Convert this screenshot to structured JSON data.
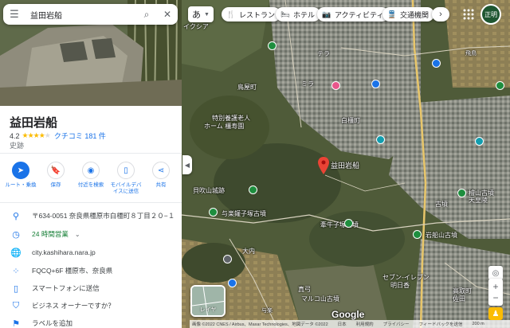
{
  "search": {
    "query": "益田岩船"
  },
  "place": {
    "name": "益田岩船",
    "rating": "4.2",
    "review_label": "クチコミ 181 件",
    "category": "史跡"
  },
  "actions": [
    {
      "label": "ルート・乗換",
      "icon": "directions-icon"
    },
    {
      "label": "保存",
      "icon": "bookmark-icon"
    },
    {
      "label": "付近を検索",
      "icon": "nearby-icon"
    },
    {
      "label": "モバイルデバイスに送信",
      "icon": "send-to-phone-icon"
    },
    {
      "label": "共有",
      "icon": "share-icon"
    }
  ],
  "info": {
    "address": "〒634-0051 奈良県橿原市白橿町８丁目２０−１",
    "hours": "24 時間営業",
    "website": "city.kashihara.nara.jp",
    "plus_code": "FQCQ+6F 橿原市、奈良県",
    "send_to_phone": "スマートフォンに送信",
    "owner": "ビジネス オーナーですか？",
    "add_label": "ラベルを追加"
  },
  "map": {
    "lang_button": "あ",
    "chips": [
      "レストラン",
      "ホテル",
      "アクティビティ",
      "交通機関"
    ],
    "avatar_text": "正明",
    "pin_label": "益田岩船",
    "labels": [
      "イクシア",
      "テラ",
      "ミラ",
      "鳥屋町",
      "白橿町",
      "特別養護老人",
      "ホーム 橿寿園",
      "貝吹山城跡",
      "与楽鑵子塚古墳",
      "牽牛子塚古墳",
      "岩船山古墳",
      "檜山古墳",
      "天皇陵",
      "古墳",
      "真弓",
      "マルコ山古墳",
      "セブン-イレブン",
      "明日香",
      "高取町",
      "佐田",
      "大内",
      "飛鳥",
      "与楽"
    ],
    "layers_label": "レイヤ",
    "google": "Google",
    "footer": [
      "画像 ©2022 CNES / Airbus、Maxar Technologies、地図データ ©2022",
      "日本",
      "利用規約",
      "プライバシー",
      "フィードバックを送信",
      "200 m"
    ]
  },
  "colors": {
    "accent": "#1a73e8",
    "star": "#fbbc04",
    "open": "#188038",
    "pin": "#ea4335"
  }
}
